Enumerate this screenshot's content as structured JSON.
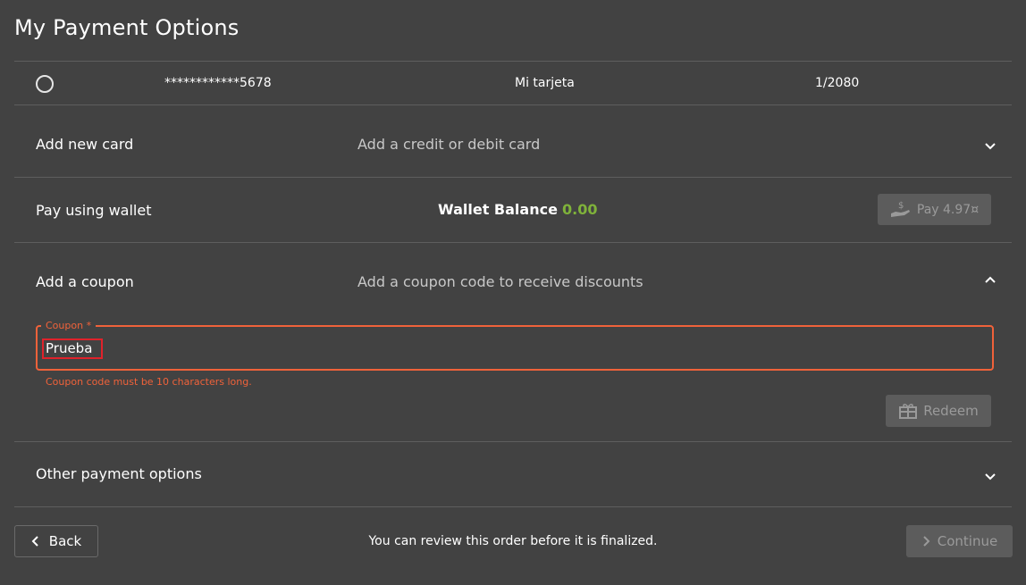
{
  "page": {
    "title": "My Payment Options"
  },
  "saved_card": {
    "number": "************5678",
    "name": "Mi tarjeta",
    "expiry": "1/2080"
  },
  "add_card": {
    "label": "Add new card",
    "description": "Add a credit or debit card",
    "icon": "chevron-down-icon"
  },
  "wallet": {
    "label": "Pay using wallet",
    "balance_label": "Wallet Balance",
    "balance_value": "0.00",
    "pay_button_label": "Pay 4.97¤",
    "balance_color": "#7fb23a"
  },
  "coupon": {
    "label": "Add a coupon",
    "description": "Add a coupon code to receive discounts",
    "field_label": "Coupon *",
    "field_value": "Prueba",
    "error": "Coupon code must be 10 characters long.",
    "redeem_label": "Redeem",
    "error_color": "#f0623a",
    "icon": "chevron-up-icon"
  },
  "other": {
    "label": "Other payment options",
    "icon": "chevron-down-icon"
  },
  "footer": {
    "back_label": "Back",
    "review_text": "You can review this order before it is finalized.",
    "continue_label": "Continue"
  }
}
